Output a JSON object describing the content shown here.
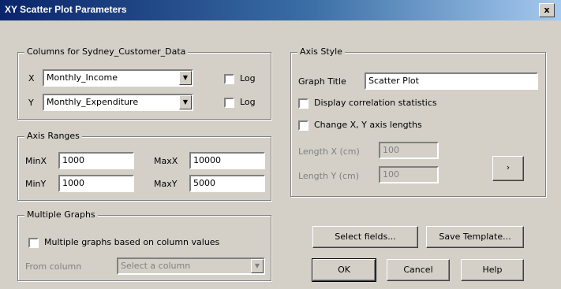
{
  "window": {
    "title": "XY Scatter Plot Parameters",
    "close_symbol": "x"
  },
  "columns_group": {
    "legend": "Columns for Sydney_Customer_Data",
    "x_label": "X",
    "x_value": "Monthly_Income",
    "y_label": "Y",
    "y_value": "Monthly_Expenditure",
    "log_label": "Log"
  },
  "axis_ranges": {
    "legend": "Axis Ranges",
    "min_x_label": "MinX",
    "min_x_value": "1000",
    "max_x_label": "MaxX",
    "max_x_value": "10000",
    "min_y_label": "MinY",
    "min_y_value": "1000",
    "max_y_label": "MaxY",
    "max_y_value": "5000"
  },
  "multiple_graphs": {
    "legend": "Multiple Graphs",
    "checkbox_label": "Multiple graphs based on column values",
    "from_column_label": "From column",
    "select_placeholder": "Select a column"
  },
  "axis_style": {
    "legend": "Axis Style",
    "graph_title_label": "Graph Title",
    "graph_title_value": "Scatter Plot",
    "display_corr_label": "Display correlation statistics",
    "change_lengths_label": "Change X, Y axis lengths",
    "length_x_label": "Length X (cm)",
    "length_x_value": "100",
    "length_y_label": "Length Y (cm)",
    "length_y_value": "100",
    "more_button": "›"
  },
  "buttons": {
    "select_fields": "Select fields...",
    "save_template": "Save Template...",
    "ok": "OK",
    "cancel": "Cancel",
    "help": "Help"
  }
}
